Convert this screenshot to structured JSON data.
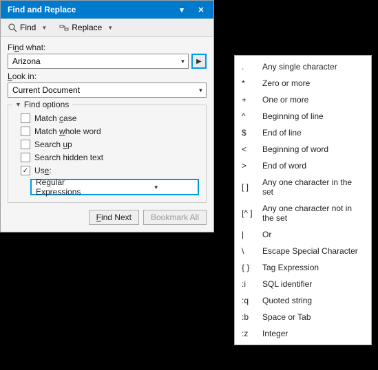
{
  "titlebar": {
    "title": "Find and Replace"
  },
  "toolbar": {
    "find_label": "Find",
    "replace_label": "Replace"
  },
  "find_what_label": "Find what:",
  "find_what_value": "Arizona",
  "look_in_label": "Look in:",
  "look_in_value": "Current Document",
  "options": {
    "header": "Find options",
    "match_case": "Match case",
    "match_whole_word": "Match whole word",
    "search_up": "Search up",
    "search_hidden": "Search hidden text",
    "use_label": "Use:",
    "use_checked": true,
    "use_value": "Regular Expressions"
  },
  "buttons": {
    "find_next": "Find Next",
    "bookmark_all": "Bookmark All"
  },
  "regex_menu": [
    {
      "sym": ".",
      "desc": "Any single character"
    },
    {
      "sym": "*",
      "desc": "Zero or more"
    },
    {
      "sym": "+",
      "desc": "One or more"
    },
    {
      "sym": "^",
      "desc": "Beginning of line"
    },
    {
      "sym": "$",
      "desc": "End of line"
    },
    {
      "sym": "<",
      "desc": "Beginning of word"
    },
    {
      "sym": ">",
      "desc": "End of word"
    },
    {
      "sym": "[ ]",
      "desc": "Any one character in the set"
    },
    {
      "sym": "[^ ]",
      "desc": "Any one character not in the set"
    },
    {
      "sym": "|",
      "desc": "Or"
    },
    {
      "sym": "\\",
      "desc": "Escape Special Character"
    },
    {
      "sym": "{ }",
      "desc": "Tag Expression"
    },
    {
      "sym": ":i",
      "desc": "SQL identifier"
    },
    {
      "sym": ":q",
      "desc": "Quoted string"
    },
    {
      "sym": ":b",
      "desc": "Space or Tab"
    },
    {
      "sym": ":z",
      "desc": "Integer"
    }
  ]
}
